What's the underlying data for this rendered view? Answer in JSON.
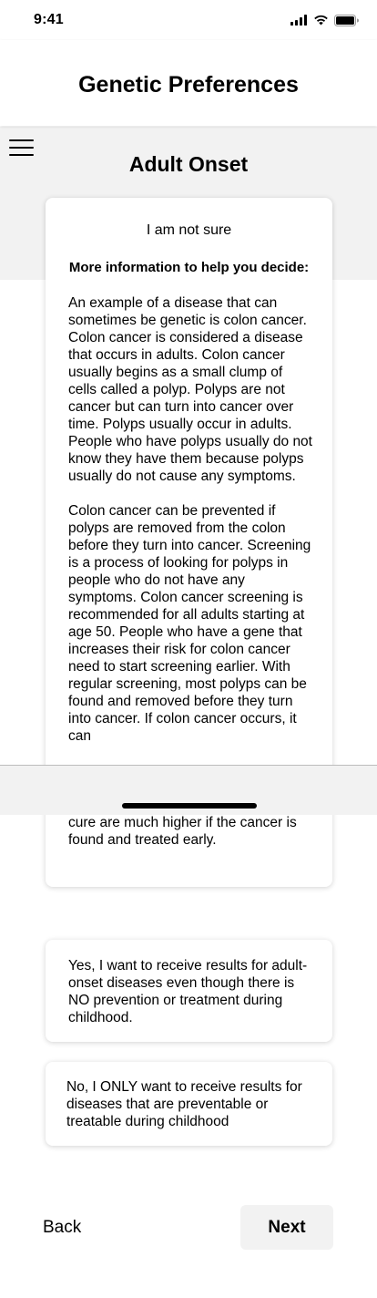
{
  "status_bar": {
    "time": "9:41",
    "icons": [
      "signal-icon",
      "wifi-icon",
      "battery-icon"
    ]
  },
  "header": {
    "title": "Genetic Preferences"
  },
  "page": {
    "title": "Adult Onset"
  },
  "info_card": {
    "selected_choice": "I am not sure",
    "heading": "More information to help you decide:",
    "paragraph_1": "An example of a disease that can sometimes be genetic is colon cancer. Colon cancer is considered a disease that occurs in adults. Colon cancer usually begins as a small clump of cells called a polyp. Polyps are not cancer but can turn into cancer over time. Polyps usually occur in adults. People who have polyps usually do not know they have them because polyps usually do not cause any symptoms.",
    "paragraph_2": "Colon cancer can be prevented if polyps are removed from the colon before they turn into cancer. Screening is a process of looking for polyps in people who do not have any symptoms. Colon cancer screening is recommended for all adults starting at age 50. People who have a gene that increases their risk for colon cancer need to start screening earlier. With regular screening, most polyps can be found and removed before they turn into cancer. If colon cancer occurs, it can",
    "paragraph_2_end": "cure are much higher if the cancer is found and treated early."
  },
  "options": {
    "yes_label": "Yes, I want to receive results for adult-onset diseases even though there is NO prevention or treatment during childhood.",
    "no_label": "No, I ONLY want to receive results for diseases that are preventable or treatable during childhood"
  },
  "footer": {
    "back_label": "Back",
    "next_label": "Next"
  },
  "colors": {
    "background": "#ffffff",
    "band": "#f2f2f2",
    "text": "#000000"
  }
}
